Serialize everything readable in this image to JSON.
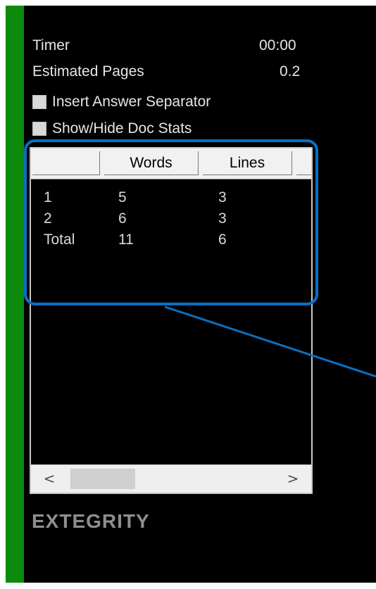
{
  "panel": {
    "timer_label": "Timer",
    "timer_value": "00:00",
    "pages_label": "Estimated Pages",
    "pages_value": "0.2",
    "insert_label": "Insert Answer Separator",
    "stats_toggle_label": "Show/Hide Doc Stats"
  },
  "table": {
    "columns": [
      "",
      "Words",
      "Lines",
      ""
    ],
    "rows": [
      {
        "name": "1",
        "words": "5",
        "lines": "3"
      },
      {
        "name": "2",
        "words": "6",
        "lines": "3"
      },
      {
        "name": "Total",
        "words": "11",
        "lines": "6"
      }
    ],
    "scroll_left": "<",
    "scroll_right": ">"
  },
  "brand": {
    "logo": "EXTEGRITY"
  },
  "colors": {
    "green_strip": "#0b8a0b",
    "background": "#000000",
    "callout": "#0a6fc2"
  }
}
